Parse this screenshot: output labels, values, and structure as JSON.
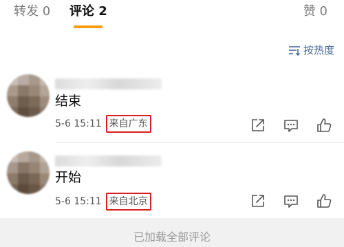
{
  "tabs": {
    "repost": "转发 0",
    "comment": "评论 2",
    "like": "赞 0",
    "accent_color": "#f39c12"
  },
  "sort": {
    "label": "按热度",
    "icon": "sort-lines-icon"
  },
  "comments": [
    {
      "text": "结束",
      "time": "5-6 15:11",
      "location": "来自广东"
    },
    {
      "text": "开始",
      "time": "5-6 15:11",
      "location": "来自北京"
    }
  ],
  "actions": {
    "share_icon": "share-icon",
    "reply_icon": "comment-icon",
    "like_icon": "thumbs-up-icon"
  },
  "footer": {
    "label": "已加载全部评论"
  },
  "colors": {
    "location_border": "#d81e1e",
    "link": "#4a6a9a"
  }
}
